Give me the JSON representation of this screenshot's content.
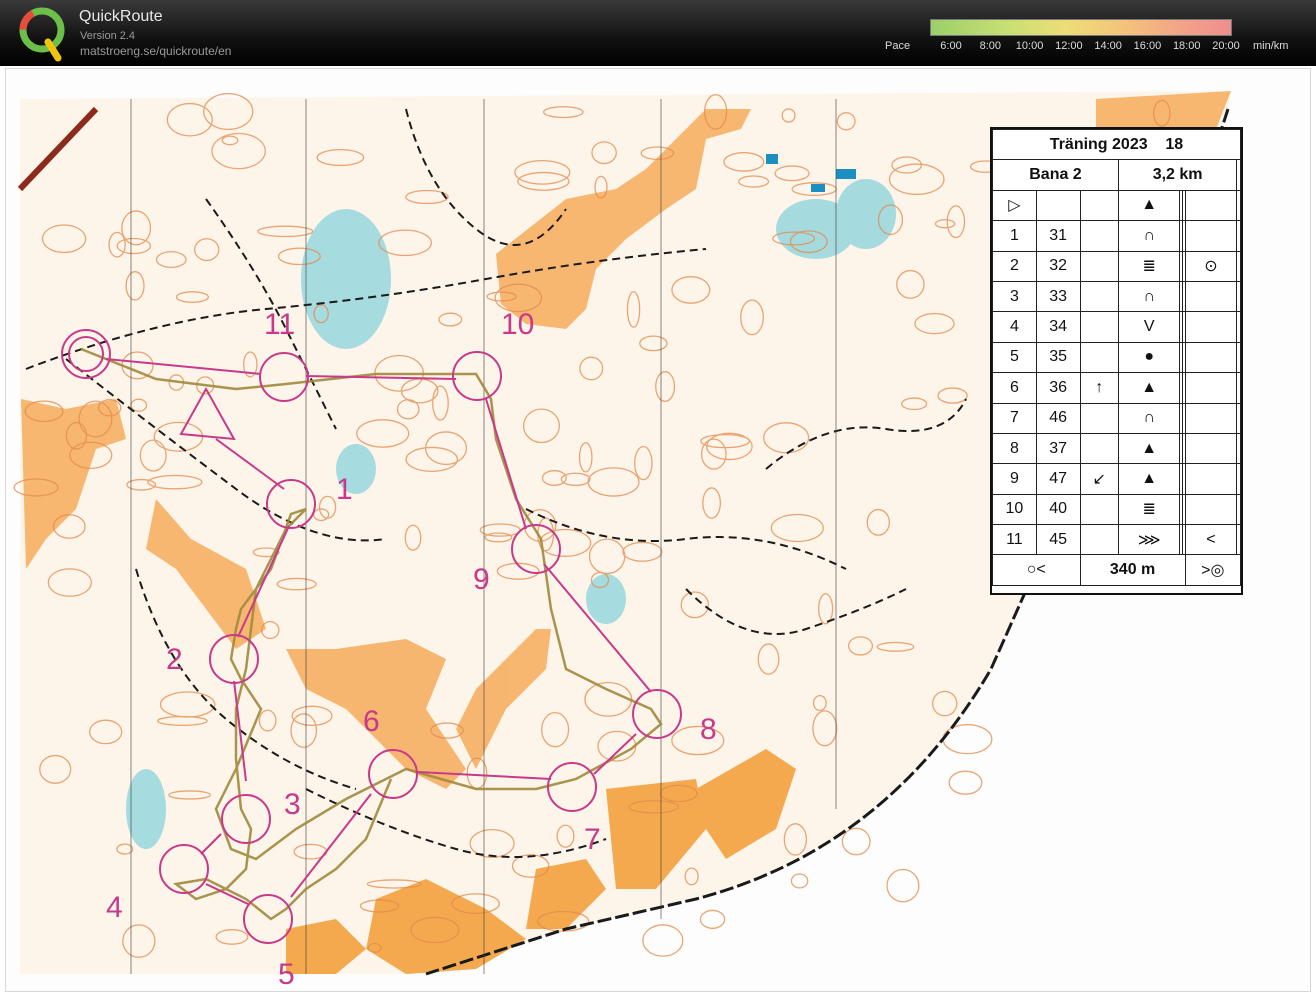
{
  "app": {
    "title": "QuickRoute",
    "version": "Version 2.4",
    "url": "matstroeng.se/quickroute/en"
  },
  "pace_legend": {
    "label": "Pace",
    "ticks": [
      "6:00",
      "8:00",
      "10:00",
      "12:00",
      "14:00",
      "16:00",
      "18:00",
      "20:00"
    ],
    "unit": "min/km"
  },
  "map": {
    "control_labels": [
      "1",
      "2",
      "3",
      "4",
      "5",
      "6",
      "7",
      "8",
      "9",
      "10",
      "11"
    ],
    "colors": {
      "route": "#a08a3c",
      "course": "#c8398a",
      "open_land": "#f7b36a",
      "contour": "#e38a4a",
      "water": "#2fb3c8",
      "path": "#1a1a1a"
    }
  },
  "description_sheet": {
    "event": "Träning 2023",
    "event_number": "18",
    "course": "Bana 2",
    "length": "3,2 km",
    "start_symbol": "▷",
    "start_feature": "▲",
    "controls": [
      {
        "num": "1",
        "code": "31",
        "dir": "",
        "feature": "∩",
        "extra": ""
      },
      {
        "num": "2",
        "code": "32",
        "dir": "",
        "feature": "≣",
        "extra": "⊙"
      },
      {
        "num": "3",
        "code": "33",
        "dir": "",
        "feature": "∩",
        "extra": ""
      },
      {
        "num": "4",
        "code": "34",
        "dir": "",
        "feature": "V",
        "extra": ""
      },
      {
        "num": "5",
        "code": "35",
        "dir": "",
        "feature": "●",
        "extra": ""
      },
      {
        "num": "6",
        "code": "36",
        "dir": "↑",
        "feature": "▲",
        "extra": ""
      },
      {
        "num": "7",
        "code": "46",
        "dir": "",
        "feature": "∩",
        "extra": ""
      },
      {
        "num": "8",
        "code": "37",
        "dir": "",
        "feature": "▲",
        "extra": ""
      },
      {
        "num": "9",
        "code": "47",
        "dir": "↙",
        "feature": "▲",
        "extra": ""
      },
      {
        "num": "10",
        "code": "40",
        "dir": "",
        "feature": "≣",
        "extra": ""
      },
      {
        "num": "11",
        "code": "45",
        "dir": "",
        "feature": "⋙",
        "extra": "<"
      }
    ],
    "finish": {
      "left_symbol": "○<",
      "distance": "340 m",
      "right_symbol": ">◎"
    }
  }
}
